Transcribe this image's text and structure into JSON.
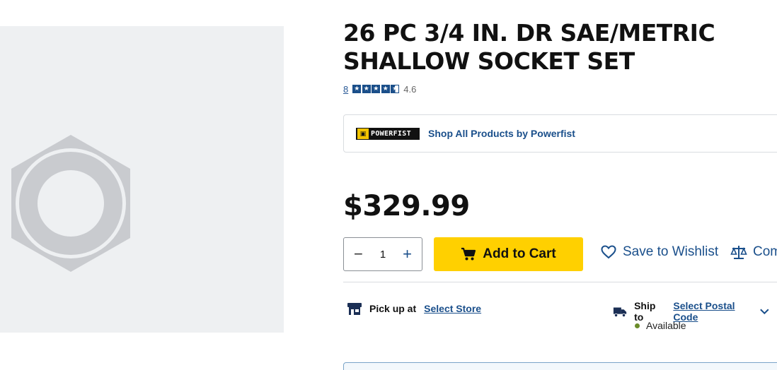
{
  "product": {
    "title": "26 PC 3/4 IN. DR SAE/METRIC SHALLOW SOCKET SET",
    "image_placeholder_icon": "hex-nut-placeholder-icon",
    "rating": {
      "count": "8",
      "value": "4.6",
      "stars": 4.6,
      "star_icon": "star-icon"
    },
    "brand": {
      "logo_text": "POWERFIST",
      "link": "Shop All Products by Powerfist"
    },
    "price": "$329.99"
  },
  "purchase": {
    "quantity": "1",
    "decrement_symbol": "−",
    "increment_symbol": "+",
    "add_to_cart": "Add to Cart",
    "wishlist": "Save to Wishlist",
    "compare": "Compare"
  },
  "fulfillment": {
    "pickup_label": "Pick up at",
    "pickup_link": "Select Store",
    "ship_label": "Ship to",
    "ship_link": "Select Postal Code",
    "availability": "Available"
  },
  "colors": {
    "accent_blue": "#1a4f8b",
    "cart_yellow": "#ffd000",
    "available_green": "#6b8c2a",
    "image_bg": "#eef0f2",
    "placeholder_gray": "#c9cbcf"
  }
}
